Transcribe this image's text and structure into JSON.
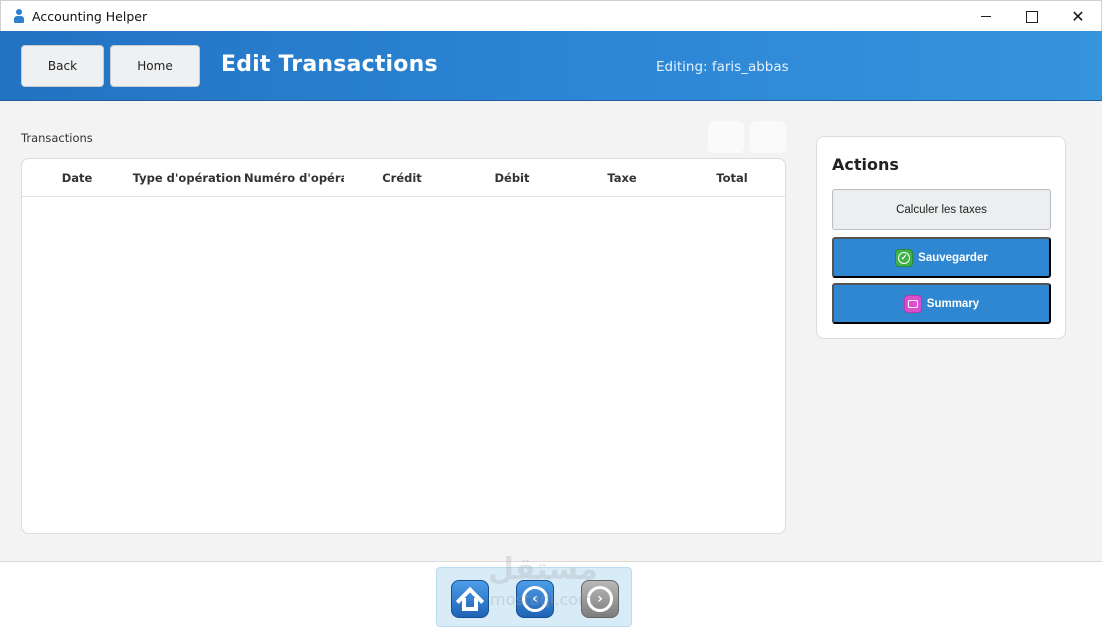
{
  "window": {
    "title": "Accounting Helper",
    "minimize_icon": "minimize-icon",
    "maximize_icon": "maximize-icon",
    "close_glyph": "✕"
  },
  "header": {
    "back_label": "Back",
    "home_label": "Home",
    "title": "Edit Transactions",
    "editing": "Editing: faris_abbas",
    "gradient_colors": [
      "#2273c2",
      "#3594dc"
    ]
  },
  "transactions": {
    "label": "Transactions",
    "columns": [
      "Date",
      "Type d'opération",
      "Numéro d'opération",
      "Crédit",
      "Débit",
      "Taxe",
      "Total"
    ],
    "rows": []
  },
  "actions": {
    "title": "Actions",
    "calculate_label": "Calculer les taxes",
    "save_label": "Sauvegarder",
    "summary_label": "Summary",
    "button_color": "#2f86d1"
  },
  "footer": {
    "dock": [
      {
        "icon": "home-icon"
      },
      {
        "icon": "back-arrow-icon"
      },
      {
        "icon": "forward-arrow-icon"
      }
    ],
    "watermark": "مستقل",
    "watermark_sub": "mostaql.com"
  }
}
